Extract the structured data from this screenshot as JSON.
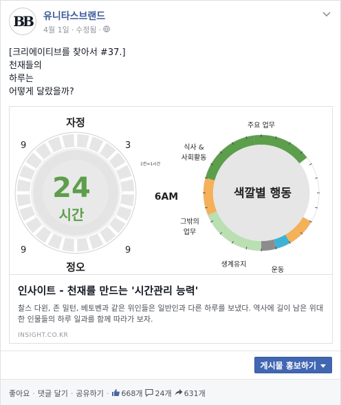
{
  "page": {
    "name": "유니타스브랜드",
    "avatar_text": "BB",
    "date": "4월 1일",
    "edited": "수정됨",
    "separator": "·"
  },
  "post": {
    "text": "[크리에이티브를 찾아서 #37.]\n천재들의\n하루는\n어떻게 달랐을까?"
  },
  "infographic": {
    "clock_top": "자정",
    "clock_bottom": "정오",
    "clock_right": "6AM",
    "clock_center_number": "24",
    "clock_center_unit": "시간",
    "tick_left_top": "9",
    "tick_right_top": "3",
    "tick_left_bottom": "9",
    "tick_right_bottom": "9",
    "tick_note": "1칸=1시간",
    "ring_center": "색깔별 행동",
    "labels": {
      "main_work": "주요 업무",
      "meal_social": "식사 &\n사회활동",
      "other_work": "그밖의\n업무",
      "living": "생계유지",
      "exercise": "운동"
    },
    "colors": {
      "main_work": "#5c9e4c",
      "meal_social": "#f5b05a",
      "other_work": "#b9dfb3",
      "living": "#8c8c8c",
      "exercise": "#3eb2d4",
      "clock_green": "#5c9e4c",
      "rest": "#ffffff"
    }
  },
  "link": {
    "title": "인사이트 - 천재를 만드는 '시간관리 능력'",
    "description": "찰스 다윈, 존 밀턴, 베토벤과 같은 위인들은 일반인과 다른 하루를 보냈다. 역사에 길이 남은 위대한 인물들의 하루 일과를 함께 따라가 보자.",
    "domain": "INSIGHT.CO.KR"
  },
  "promote": {
    "label": "게시물 홍보하기"
  },
  "footer": {
    "like": "좋아요",
    "comment": "댓글 달기",
    "share": "공유하기",
    "dot": "·",
    "likes_count": "668개",
    "comments_count": "24개",
    "shares_count": "631개"
  }
}
